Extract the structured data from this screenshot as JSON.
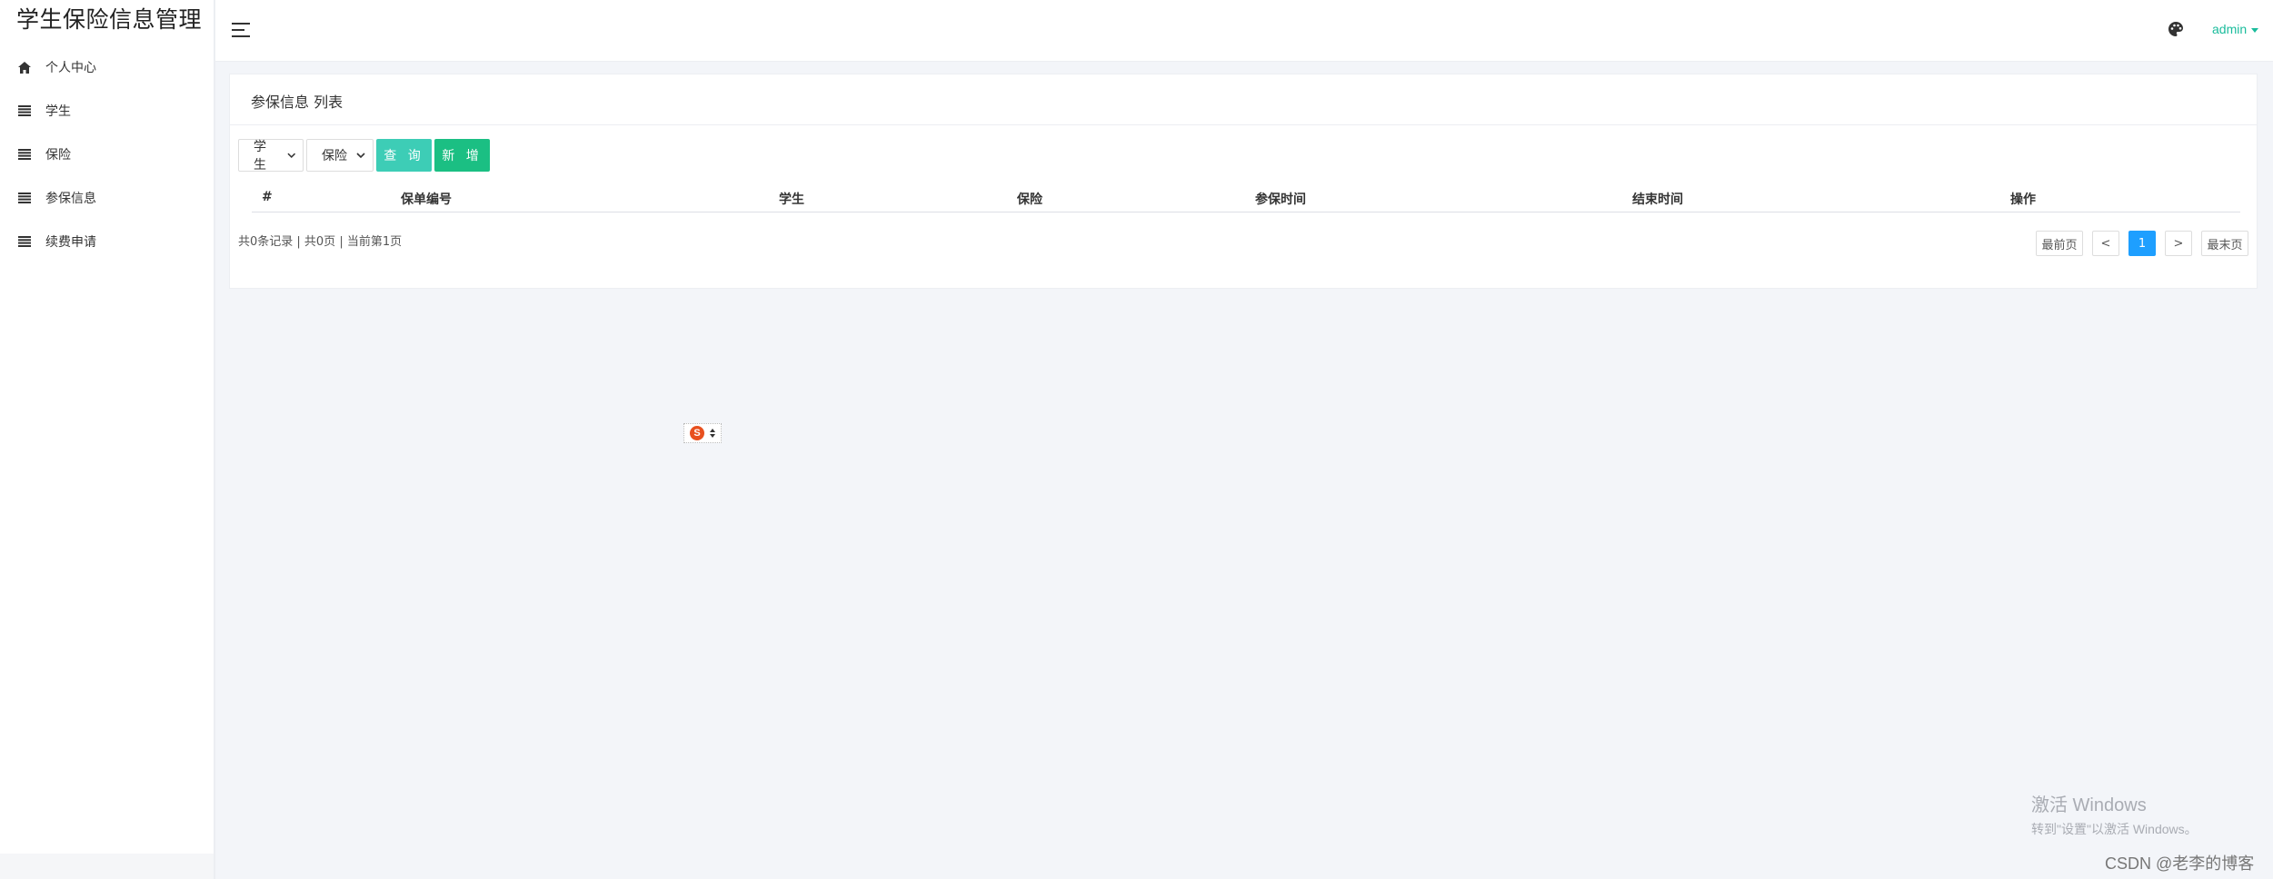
{
  "app": {
    "title": "学生保险信息管理"
  },
  "sidebar": {
    "items": [
      {
        "label": "个人中心",
        "icon": "home-icon"
      },
      {
        "label": "学生",
        "icon": "list-icon"
      },
      {
        "label": "保险",
        "icon": "list-icon"
      },
      {
        "label": "参保信息",
        "icon": "list-icon"
      },
      {
        "label": "续费申请",
        "icon": "list-icon"
      }
    ]
  },
  "header": {
    "menu_icon": "hamburger-icon",
    "theme_icon": "palette-icon",
    "user": "admin"
  },
  "panel": {
    "title": "参保信息 列表"
  },
  "toolbar": {
    "student_select": "学生",
    "insurance_select": "保险",
    "query_label": "查 询",
    "add_label": "新 增"
  },
  "table": {
    "columns": [
      "#",
      "保单编号",
      "学生",
      "保险",
      "参保时间",
      "结束时间",
      "操作"
    ],
    "rows": []
  },
  "pagination": {
    "info": "共0条记录 | 共0页 | 当前第1页",
    "first": "最前页",
    "prev": "<",
    "current": "1",
    "next": ">",
    "last": "最末页"
  },
  "overlay": {
    "windows_title": "激活 Windows",
    "windows_sub": "转到\"设置\"以激活 Windows。",
    "csdn": "CSDN @老李的博客",
    "ime_logo": "S"
  },
  "colors": {
    "accent": "#1abc9c",
    "query_button": "#3dcdb6",
    "add_button": "#1bbf83",
    "page_active": "#1e9fff",
    "background": "#f3f5f9"
  }
}
